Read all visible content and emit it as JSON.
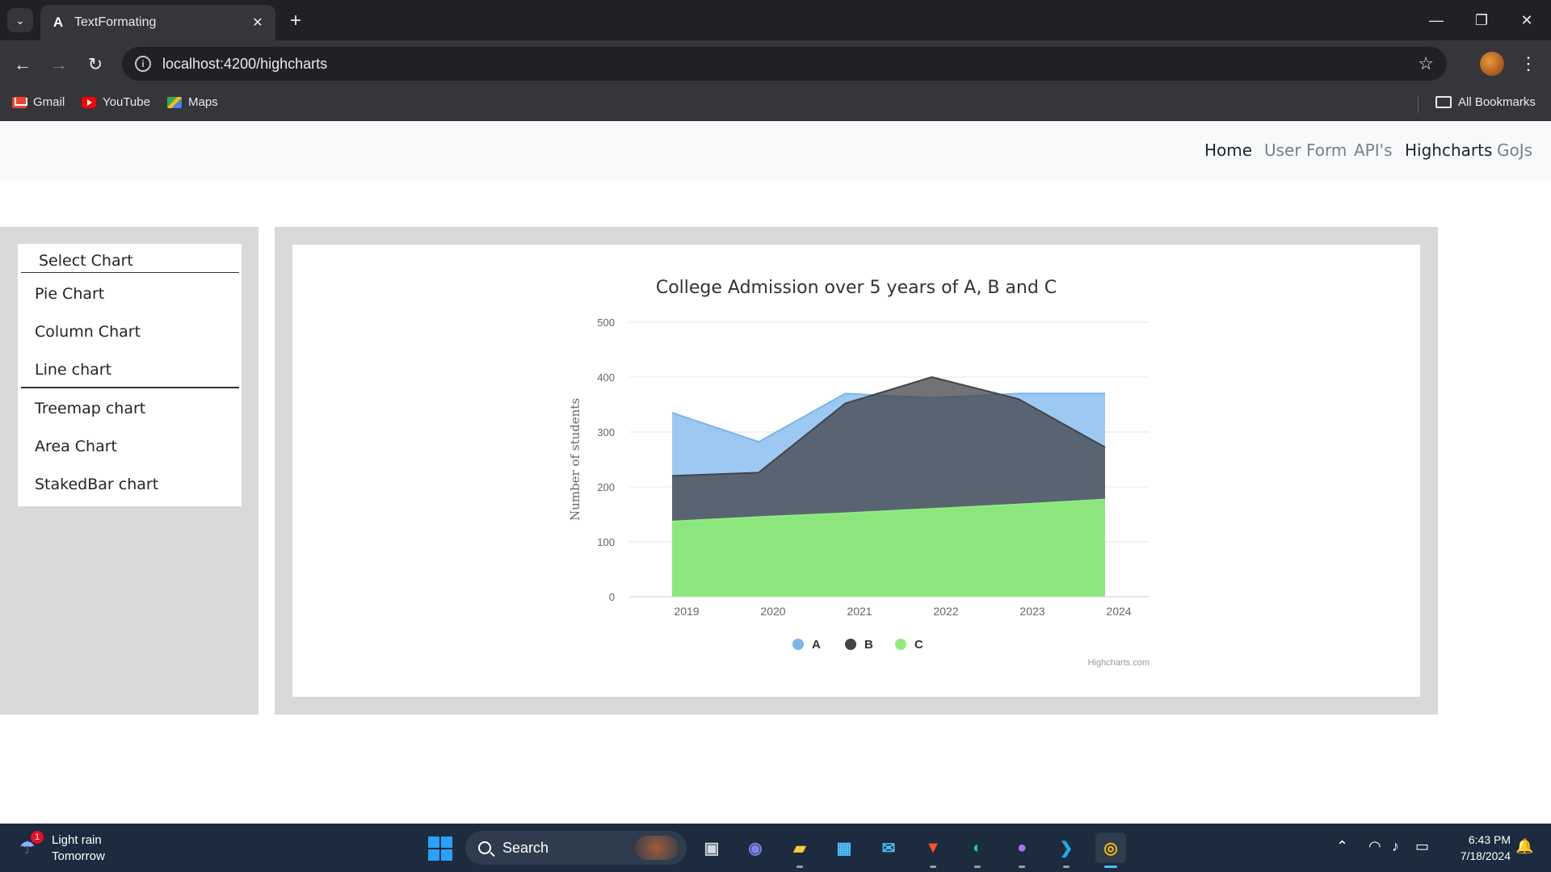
{
  "browser": {
    "tab_title": "TextFormating",
    "url": "localhost:4200/highcharts",
    "bookmarks": [
      "Gmail",
      "YouTube",
      "Maps"
    ],
    "all_bookmarks": "All Bookmarks"
  },
  "app_nav": {
    "links": [
      "Home",
      "User Form",
      "API's",
      "Highcharts",
      "GoJs"
    ]
  },
  "sidebar": {
    "header": "Select Chart",
    "items": [
      "Pie Chart",
      "Column Chart",
      "Line chart",
      "Treemap chart",
      "Area Chart",
      "StakedBar chart"
    ]
  },
  "chart_data": {
    "type": "area",
    "title": "College Admission over 5 years of A, B and C",
    "ylabel": "Number of students",
    "xlabel": "",
    "categories": [
      "2019",
      "2020",
      "2021",
      "2022",
      "2023",
      "2024"
    ],
    "ylim": [
      0,
      500
    ],
    "yticks": [
      0,
      100,
      200,
      300,
      400,
      500
    ],
    "series": [
      {
        "name": "A",
        "color": "#7cb5ec",
        "values": [
          335,
          282,
          370,
          362,
          370,
          370
        ]
      },
      {
        "name": "B",
        "color": "#434348",
        "values": [
          220,
          226,
          352,
          400,
          360,
          272
        ]
      },
      {
        "name": "C",
        "color": "#90ed7d",
        "values": [
          137,
          145,
          152,
          160,
          168,
          177
        ]
      }
    ],
    "legend_position": "bottom-center",
    "credits": "Highcharts.com"
  },
  "taskbar": {
    "weather_title": "Light rain",
    "weather_sub": "Tomorrow",
    "weather_badge": "1",
    "search_placeholder": "Search",
    "time": "6:43 PM",
    "date": "7/18/2024"
  }
}
